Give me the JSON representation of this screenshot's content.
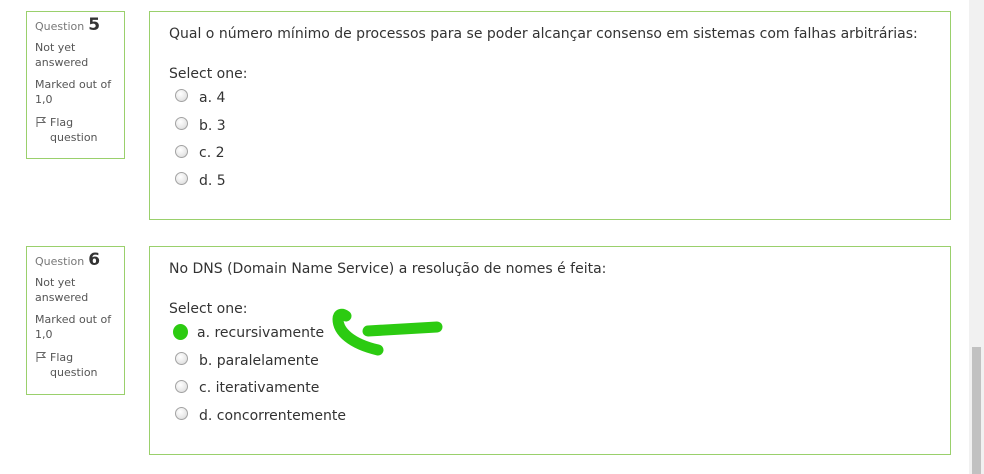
{
  "questions": [
    {
      "question_label": "Question",
      "number": "5",
      "state": "Not yet answered",
      "grade": "Marked out of 1,0",
      "flag_label": "Flag question",
      "text": "Qual o número mínimo de processos para se poder alcançar consenso em sistemas com falhas arbitrárias:",
      "prompt": "Select one:",
      "answers": [
        "a. 4",
        "b. 3",
        "c. 2",
        "d. 5"
      ]
    },
    {
      "question_label": "Question",
      "number": "6",
      "state": "Not yet answered",
      "grade": "Marked out of 1,0",
      "flag_label": "Flag question",
      "text": "No DNS (Domain Name Service) a resolução de nomes é feita:",
      "prompt": "Select one:",
      "answers": [
        "a. recursivamente",
        "b. paralelamente",
        "c. iterativamente",
        "d. concorrentemente"
      ],
      "marked_answer_index": 0
    }
  ],
  "colors": {
    "box_border": "#9ad06c",
    "annotation": "#2ccb11",
    "text": "#333333",
    "muted": "#555555"
  },
  "icons": [
    "flag-icon",
    "radio-icon",
    "arrow-annotation-icon"
  ]
}
